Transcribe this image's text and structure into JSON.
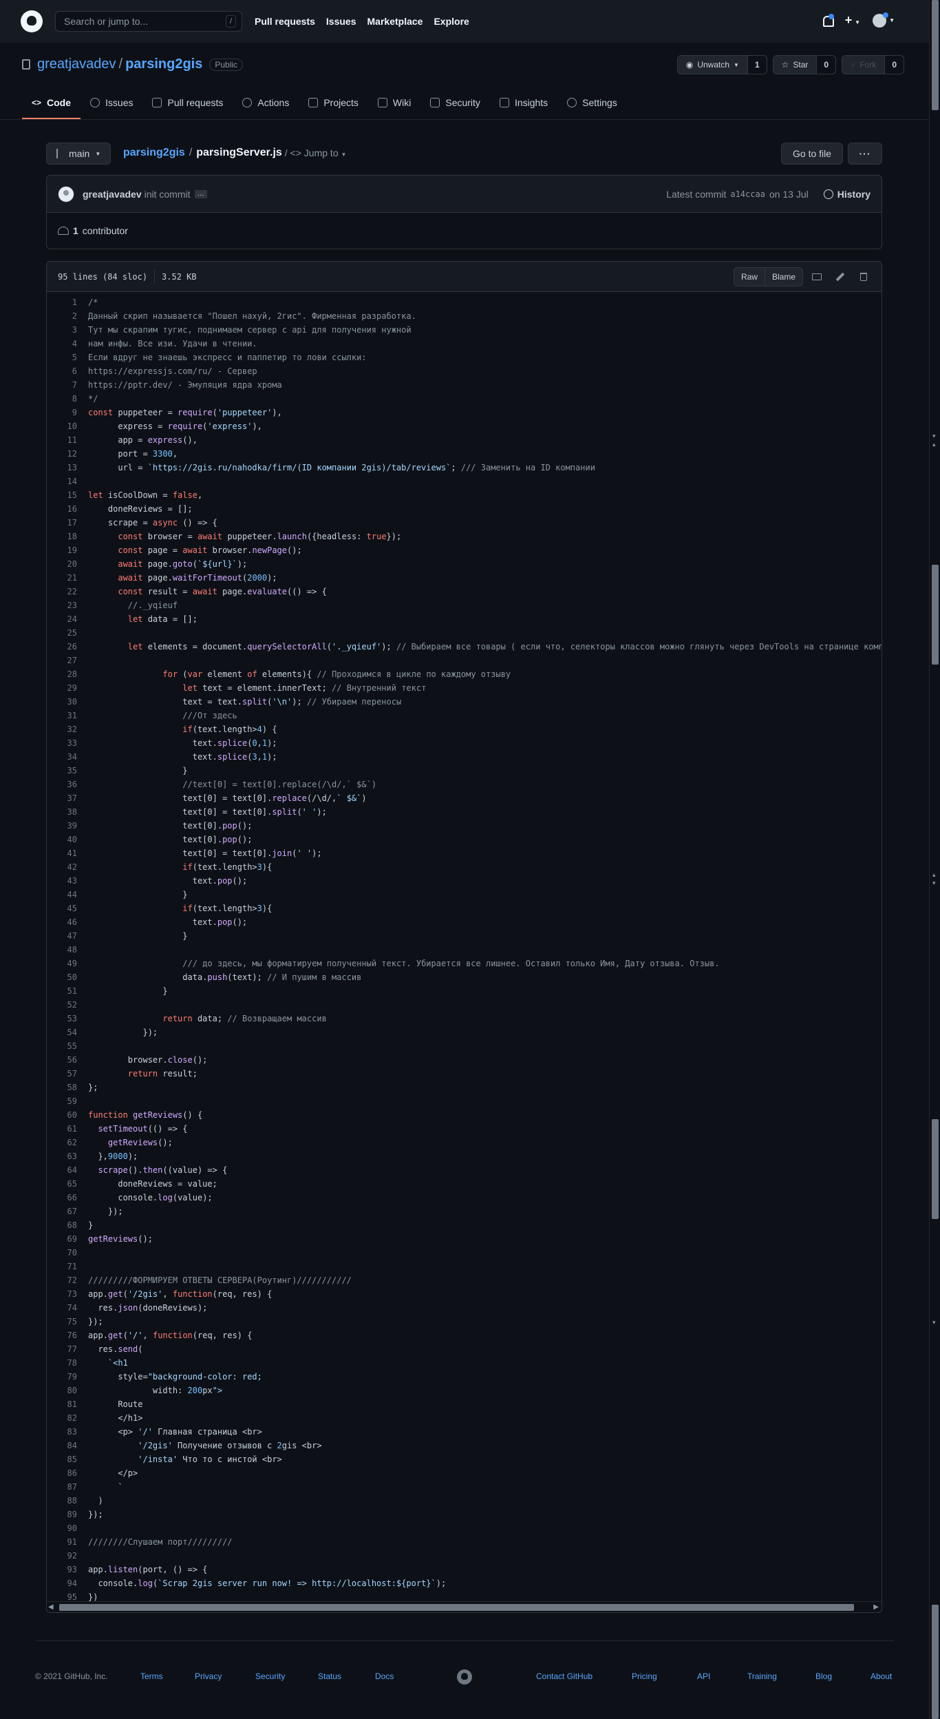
{
  "header": {
    "search_placeholder": "Search or jump to...",
    "search_shortcut": "/",
    "nav": [
      "Pull requests",
      "Issues",
      "Marketplace",
      "Explore"
    ],
    "plus": "+"
  },
  "repo": {
    "owner": "greatjavadev",
    "name": "parsing2gis",
    "visibility": "Public",
    "unwatch_label": "Unwatch",
    "watch_count": "1",
    "star_label": "Star",
    "star_count": "0",
    "fork_label": "Fork",
    "fork_count": "0",
    "tabs": [
      "Code",
      "Issues",
      "Pull requests",
      "Actions",
      "Projects",
      "Wiki",
      "Security",
      "Insights",
      "Settings"
    ]
  },
  "file_nav": {
    "branch": "main",
    "repo_link": "parsing2gis",
    "separator": "/",
    "file_name": "parsingServer.js",
    "jump_to": "/ <> Jump to",
    "go_to_file": "Go to file",
    "more": "···"
  },
  "commit": {
    "author": "greatjavadev",
    "message": "init commit",
    "ellipsis": "…",
    "latest_prefix": "Latest commit",
    "sha": "a14ccaa",
    "date": "on 13 Jul",
    "history": "History",
    "contributors_count": "1",
    "contributors_label": "contributor"
  },
  "file": {
    "lines_info": "95 lines (84 sloc)",
    "size": "3.52 KB",
    "raw": "Raw",
    "blame": "Blame",
    "code": [
      "/*",
      "Данный скрип называется \"Пошел нахуй, 2гис\". Фирменная разработка.",
      "Тут мы скрапим тугис, поднимаем сервер с api для получения нужной",
      "нам инфы. Все изи. Удачи в чтении.",
      "Если вдруг не знаешь экспресс и паппетир то лови ссылки:",
      "https://expressjs.com/ru/ - Сервер",
      "https://pptr.dev/ - Эмуляция ядра хрома",
      "*/",
      "const puppeteer = require('puppeteer'),",
      "      express = require('express'),",
      "      app = express(),",
      "      port = 3300,",
      "      url = `https://2gis.ru/nahodka/firm/(ID компании 2gis)/tab/reviews`; /// Заменить на ID компании",
      "",
      "let isCoolDown = false,",
      "    doneReviews = [];",
      "    scrape = async () => {",
      "      const browser = await puppeteer.launch({headless: true});",
      "      const page = await browser.newPage();",
      "      await page.goto(`${url}`);",
      "      await page.waitForTimeout(2000);",
      "      const result = await page.evaluate(() => {",
      "        //._yqieuf",
      "        let data = [];",
      "",
      "        let elements = document.querySelectorAll('._yqieuf'); // Выбираем все товары ( если что, селекторы классов можно глянуть через DevTools на странице компании",
      "",
      "               for (var element of elements){ // Проходимся в цикле по каждому отзыву",
      "                   let text = element.innerText; // Внутренний текст",
      "                   text = text.split('\\n'); // Убираем переносы",
      "                   ///От здесь",
      "                   if(text.length>4) {",
      "                     text.splice(0,1);",
      "                     text.splice(3,1);",
      "                   }",
      "                   //text[0] = text[0].replace(/\\d/,` $&`)",
      "                   text[0] = text[0].replace(/\\d/,` $&`)",
      "                   text[0] = text[0].split(' ');",
      "                   text[0].pop();",
      "                   text[0].pop();",
      "                   text[0] = text[0].join(' ');",
      "                   if(text.length>3){",
      "                     text.pop();",
      "                   }",
      "                   if(text.length>3){",
      "                     text.pop();",
      "                   }",
      "",
      "                   /// до здесь, мы форматируем полученный текст. Убирается все лишнее. Оставил только Имя, Дату отзыва. Отзыв.",
      "                   data.push(text); // И пушим в массив",
      "               }",
      "",
      "               return data; // Возвращаем массив",
      "           });",
      "",
      "        browser.close();",
      "        return result;",
      "};",
      "",
      "function getReviews() {",
      "  setTimeout(() => {",
      "    getReviews();",
      "  },9000);",
      "  scrape().then((value) => {",
      "      doneReviews = value;",
      "      console.log(value);",
      "    });",
      "}",
      "getReviews();",
      "",
      "",
      "/////////ФОРМИРУЕМ ОТВЕТЫ СЕРВЕРА(Роутинг)///////////",
      "app.get('/2gis', function(req, res) {",
      "  res.json(doneReviews);",
      "});",
      "app.get('/', function(req, res) {",
      "  res.send(",
      "    `<h1",
      "      style=\"background-color: red;",
      "             width: 200px\">",
      "      Route",
      "      </h1>",
      "      <p> '/' Главная страница <br>",
      "          '/2gis' Получение отзывов с 2gis <br>",
      "          '/insta' Что то с инстой <br>",
      "      </p>",
      "      `",
      "  )",
      "});",
      "",
      "////////Слушаем порт/////////",
      "",
      "app.listen(port, () => {",
      "  console.log(`Scrap 2gis server run now! => http://localhost:${port}`);",
      "})"
    ]
  },
  "footer": {
    "copyright": "© 2021 GitHub, Inc.",
    "links_left": [
      "Terms",
      "Privacy",
      "Security",
      "Status",
      "Docs"
    ],
    "links_right": [
      "Contact GitHub",
      "Pricing",
      "API",
      "Training",
      "Blog",
      "About"
    ]
  },
  "colors": {
    "background": "#0d1117",
    "header": "#161b22",
    "link": "#58a6ff",
    "active_tab": "#f78166",
    "keyword": "#ff7b72",
    "string": "#a5d6ff",
    "function": "#d2a8ff",
    "comment": "#8b949e",
    "number": "#79c0ff"
  }
}
